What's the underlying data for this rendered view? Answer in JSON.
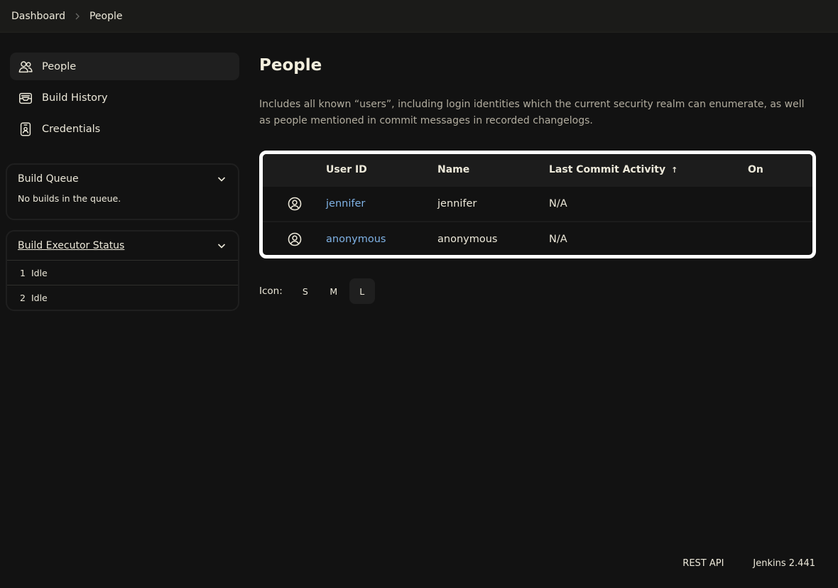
{
  "breadcrumb": {
    "items": [
      "Dashboard",
      "People"
    ]
  },
  "sidebar": {
    "items": [
      {
        "label": "People",
        "icon": "people-icon"
      },
      {
        "label": "Build History",
        "icon": "inbox-icon"
      },
      {
        "label": "Credentials",
        "icon": "id-badge-icon"
      }
    ]
  },
  "build_queue": {
    "title": "Build Queue",
    "empty_text": "No builds in the queue."
  },
  "executor_status": {
    "title": "Build Executor Status",
    "executors": [
      {
        "num": "1",
        "state": "Idle"
      },
      {
        "num": "2",
        "state": "Idle"
      }
    ]
  },
  "main": {
    "title": "People",
    "description": "Includes all known “users”, including login identities which the current security realm can enumerate, as well as people mentioned in commit messages in recorded changelogs."
  },
  "table": {
    "headers": {
      "user_id": "User ID",
      "name": "Name",
      "last_commit": "Last Commit Activity",
      "sort_indicator": "↑",
      "on": "On"
    },
    "rows": [
      {
        "user_id": "jennifer",
        "name": "jennifer",
        "last_commit": "N/A",
        "on": ""
      },
      {
        "user_id": "anonymous",
        "name": "anonymous",
        "last_commit": "N/A",
        "on": ""
      }
    ]
  },
  "icon_size": {
    "label": "Icon:",
    "options": [
      "S",
      "M",
      "L"
    ],
    "selected": "L"
  },
  "footer": {
    "rest_api": "REST API",
    "version": "Jenkins 2.441"
  },
  "colors": {
    "background": "#121212",
    "link": "#7fb2e5",
    "text": "#ece8d9"
  }
}
